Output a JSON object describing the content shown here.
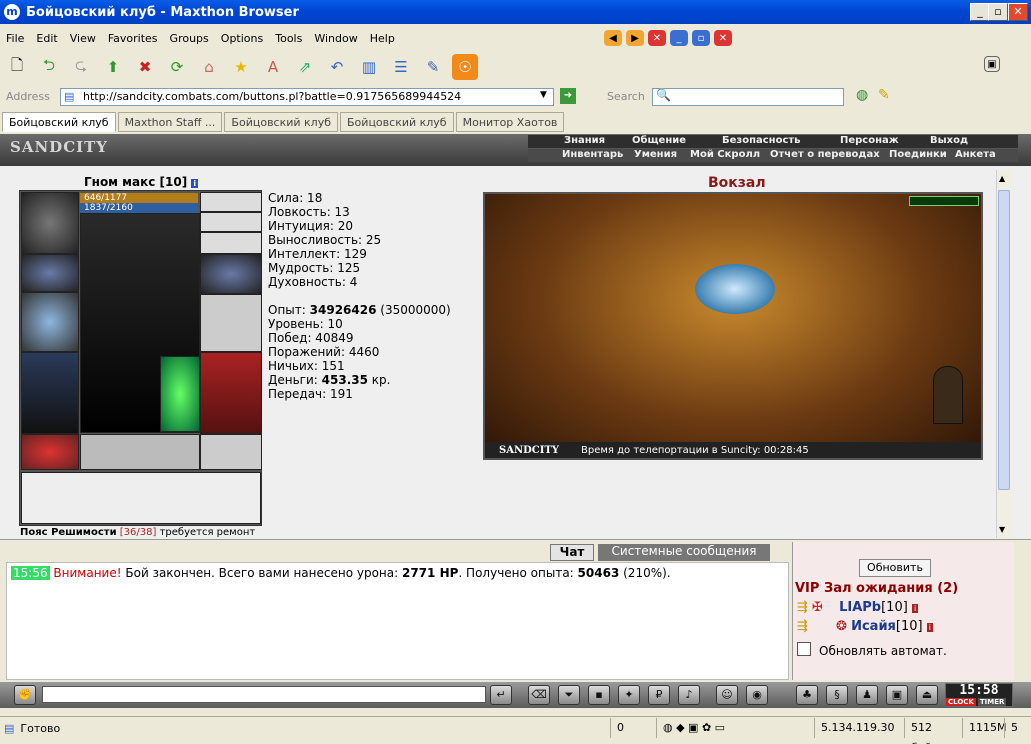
{
  "window": {
    "title": "Бойцовский клуб - Maxthon Browser"
  },
  "menu": [
    "File",
    "Edit",
    "View",
    "Favorites",
    "Groups",
    "Options",
    "Tools",
    "Window",
    "Help"
  ],
  "address": {
    "label": "Address",
    "url": "http://sandcity.combats.com/buttons.pl?battle=0.917565689944524",
    "search_label": "Search"
  },
  "tabs": [
    "Бойцовский клуб",
    "Maxthon Staff ...",
    "Бойцовский клуб",
    "Бойцовский клуб",
    "Монитор Хаотов"
  ],
  "game": {
    "logo": "SANDCITY",
    "nav_top": [
      "Знания",
      "Общение",
      "Безопасность",
      "Персонаж",
      "Выход"
    ],
    "nav_bottom": [
      "Инвентарь",
      "Умения",
      "Мой Скролл",
      "Отчет о переводах",
      "Поединки",
      "Анкета"
    ]
  },
  "character": {
    "name": "Гном макс [10]",
    "hp": "646/1177",
    "mana": "1837/2160",
    "stats": [
      "Сила: 18",
      "Ловкость: 13",
      "Интуиция: 20",
      "Выносливость: 25",
      "Интеллект: 129",
      "Мудрость: 125",
      "Духовность: 4"
    ],
    "exp_label": "Опыт:",
    "exp_value": "34926426",
    "exp_next": "(35000000)",
    "info": [
      "Уровень: 10",
      "Побед: 40849",
      "Поражений: 4460",
      "Ничьих: 151"
    ],
    "money_label": "Деньги:",
    "money_value": "453.35",
    "money_unit": "кр.",
    "transfers": "Передач: 191",
    "belt_name": "Пояс Решимости",
    "belt_durability": "[36/38]",
    "belt_note": "требуется ремонт"
  },
  "location": {
    "title": "Вокзал",
    "logo": "SANDCITY",
    "timer_text": "Время до телепортации в Suncity: 00:28:45"
  },
  "chat": {
    "tab_chat": "Чат",
    "tab_system": "Системные сообщения",
    "time": "15:56",
    "warning": "Внимание!",
    "message_a": "Бой закончен. Всего вами нанесено урона:",
    "damage": "2771 HP",
    "message_b": ". Получено опыта:",
    "exp": "50463",
    "exp_pct": "(210%)."
  },
  "sidebar": {
    "refresh_label": "Обновить",
    "room_title": "VIP Зал ожидания (2)",
    "users": [
      {
        "name": "LIAPb",
        "level": "[10]"
      },
      {
        "name": "Исайя",
        "level": "[10]"
      }
    ],
    "auto_refresh_label": "Обновлять автомат."
  },
  "clock": {
    "time": "15:58",
    "clock_label": "CLOCK",
    "timer_label": "TIMER"
  },
  "status": {
    "text": "Готово",
    "zero": "0",
    "ip": "5.134.119.30",
    "bytes": "512 байт",
    "mem": "1115M",
    "count": "5"
  },
  "colors": {
    "titlebar": "#0047d6",
    "location_title": "#8b1a1a",
    "warning": "#cc0000",
    "time_bg": "#33dd66",
    "room_title": "#8b0000",
    "user_name": "#1a3a8a"
  }
}
